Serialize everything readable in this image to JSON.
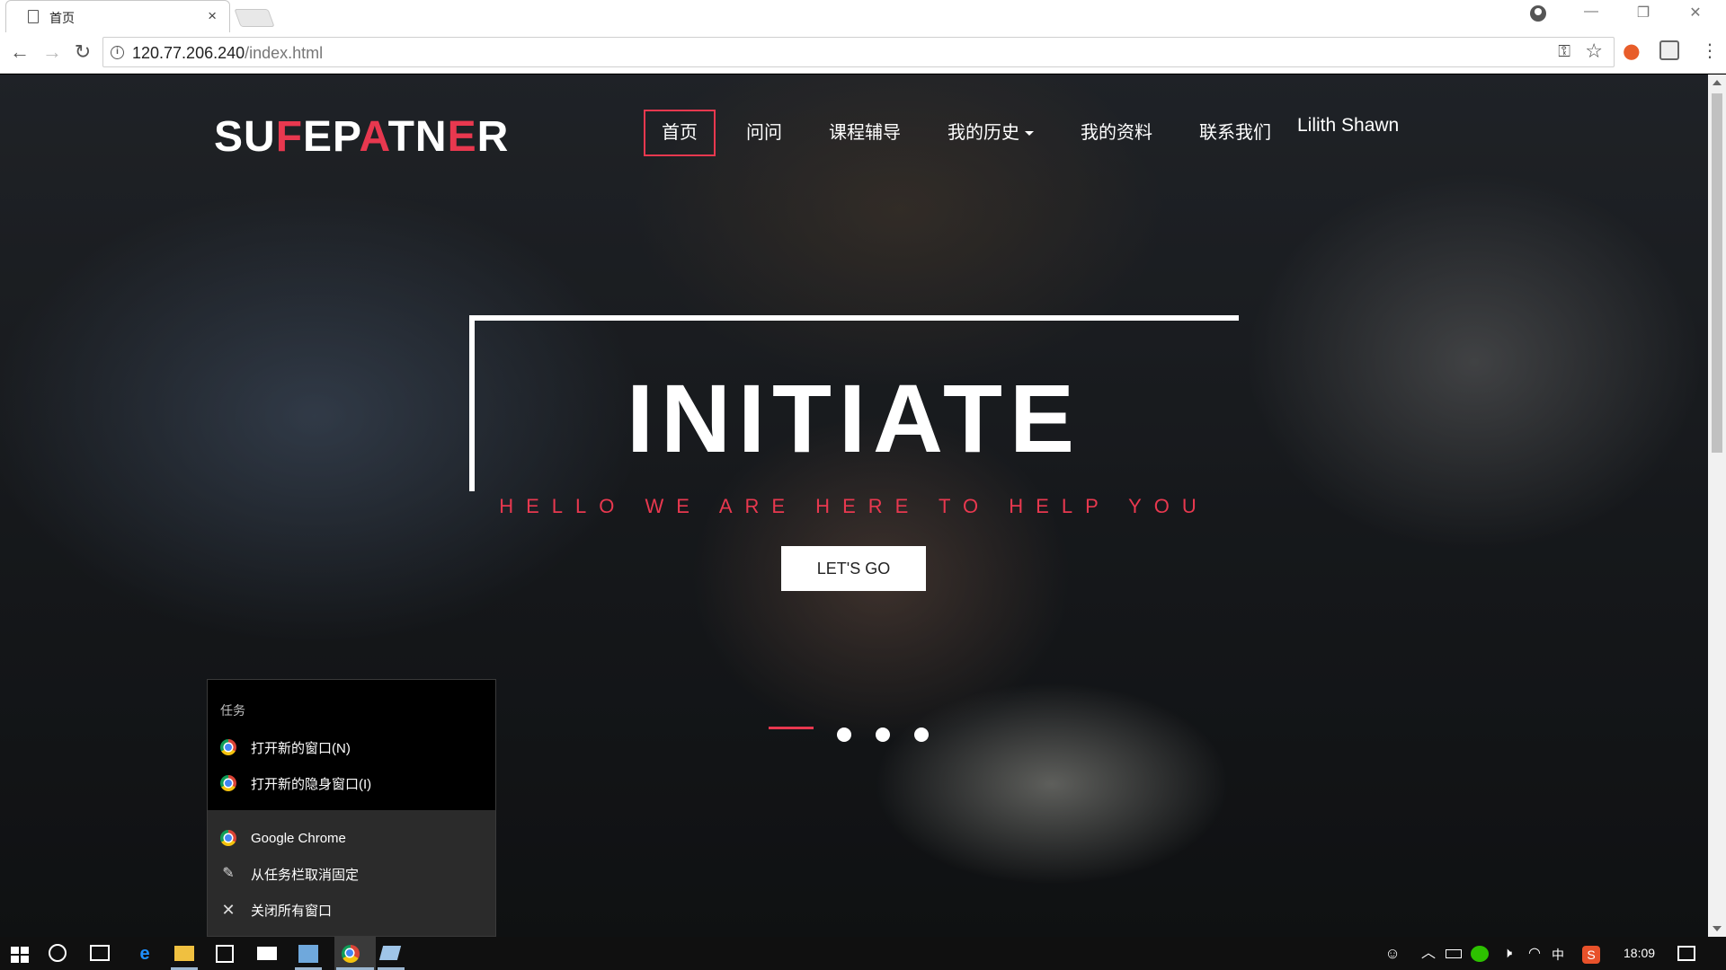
{
  "browser": {
    "tab_title": "首页",
    "tab_close": "×",
    "url_host": "120.77.206.240",
    "url_path": "/index.html",
    "window_controls": {
      "minimize": "—",
      "restore": "❐",
      "close": "✕"
    }
  },
  "site": {
    "logo_parts": [
      "SU",
      "F",
      "EP",
      "A",
      "TN",
      "E",
      "R"
    ],
    "nav": [
      {
        "label": "首页",
        "active": true
      },
      {
        "label": "问问"
      },
      {
        "label": "课程辅导"
      },
      {
        "label": "我的历史",
        "has_dropdown": true
      },
      {
        "label": "我的资料"
      },
      {
        "label": "联系我们"
      }
    ],
    "user_name": "Lilith Shawn",
    "hero": {
      "title": "INITIATE",
      "subtitle": "HELLO WE ARE HERE TO HELP YOU",
      "button": "LET'S GO"
    },
    "slider": {
      "total": 4,
      "active_index": 0
    }
  },
  "jumplist": {
    "header": "任务",
    "tasks": [
      "打开新的窗口(N)",
      "打开新的隐身窗口(I)"
    ],
    "actions": [
      "Google Chrome",
      "从任务栏取消固定",
      "关闭所有窗口"
    ]
  },
  "taskbar": {
    "clock": "18:09",
    "ime": "中"
  },
  "colors": {
    "accent": "#e8384f"
  }
}
